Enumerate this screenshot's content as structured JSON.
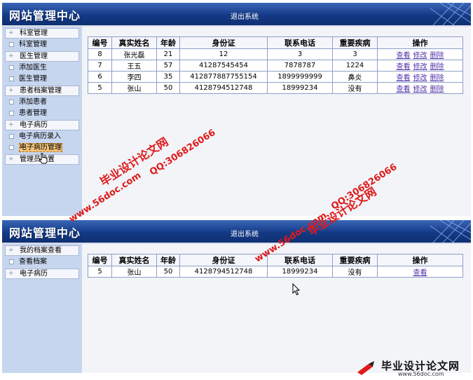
{
  "site_title": "网站管理中心",
  "logout_label": "退出系统",
  "admin": {
    "sidebar": [
      {
        "type": "cat",
        "label": "科室管理"
      },
      {
        "type": "sub",
        "label": "科室管理"
      },
      {
        "type": "cat",
        "label": "医生管理"
      },
      {
        "type": "sub",
        "label": "添加医生"
      },
      {
        "type": "sub",
        "label": "医生管理"
      },
      {
        "type": "cat",
        "label": "患者档案管理"
      },
      {
        "type": "sub",
        "label": "添加患者"
      },
      {
        "type": "sub",
        "label": "患者管理"
      },
      {
        "type": "cat",
        "label": "电子病历"
      },
      {
        "type": "sub",
        "label": "电子病历录入"
      },
      {
        "type": "sub",
        "label": "电子病历管理",
        "highlight": true
      },
      {
        "type": "cat",
        "label": "管理员设置"
      }
    ],
    "columns": [
      "编号",
      "真实姓名",
      "年龄",
      "身份证",
      "联系电话",
      "重要疾病",
      "操作"
    ],
    "rows": [
      [
        "8",
        "张光磊",
        "21",
        "12",
        "3",
        "3"
      ],
      [
        "7",
        "王五",
        "57",
        "41287545454",
        "7878787",
        "1224"
      ],
      [
        "6",
        "李四",
        "35",
        "412877887755154",
        "1899999999",
        "鼻炎"
      ],
      [
        "5",
        "张山",
        "50",
        "4128794512748",
        "18999234",
        "没有"
      ]
    ],
    "actions": [
      "查看",
      "修改",
      "删除"
    ]
  },
  "patient": {
    "sidebar": [
      {
        "type": "cat",
        "label": "我的档案查看"
      },
      {
        "type": "sub",
        "label": "查看档案"
      },
      {
        "type": "cat",
        "label": "电子病历"
      }
    ],
    "columns": [
      "编号",
      "真实姓名",
      "年龄",
      "身份证",
      "联系电话",
      "重要疾病",
      "操作"
    ],
    "rows": [
      [
        "5",
        "张山",
        "50",
        "4128794512748",
        "18999234",
        "没有"
      ]
    ],
    "actions": [
      "查看"
    ]
  },
  "watermarks": {
    "site": "www.56doc.com",
    "name": "毕业设计论文网",
    "qq": "QQ:306826066"
  },
  "brand": {
    "name": "毕业设计论文网",
    "url": "www.56doc.com"
  },
  "colors": {
    "header": "#143a86",
    "sidebar": "#c7d6ef",
    "link": "#5533aa",
    "watermark": "#e01a1a"
  }
}
